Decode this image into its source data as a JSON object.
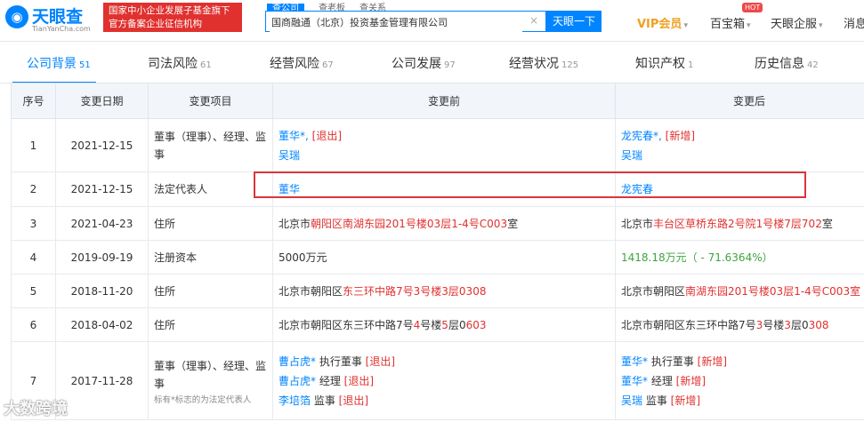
{
  "header": {
    "logo_icon": "eye-icon",
    "logo_name": "天眼查",
    "logo_sub": "TianYanCha.com",
    "gov_line1": "国家中小企业发展子基金旗下",
    "gov_line2": "官方备案企业征信机构",
    "search_tabs": [
      "查公司",
      "查老板",
      "查关系"
    ],
    "search_value": "国商融通（北京）投资基金管理有限公司",
    "search_button": "天眼一下",
    "vip": "VIP会员",
    "baobox": "百宝箱",
    "hot": "HOT",
    "enterprise": "天眼企服",
    "msg": "消息"
  },
  "nav": [
    {
      "label": "公司背景",
      "count": "51"
    },
    {
      "label": "司法风险",
      "count": "61"
    },
    {
      "label": "经营风险",
      "count": "67"
    },
    {
      "label": "公司发展",
      "count": "97"
    },
    {
      "label": "经营状况",
      "count": "125"
    },
    {
      "label": "知识产权",
      "count": "1"
    },
    {
      "label": "历史信息",
      "count": "42"
    }
  ],
  "table": {
    "headers": [
      "序号",
      "变更日期",
      "变更项目",
      "变更前",
      "变更后"
    ],
    "rows": [
      {
        "num": "1",
        "date": "2021-12-15",
        "item": "董事（理事）、经理、监事",
        "before": [
          [
            {
              "t": "董华*, ",
              "c": "nm"
            },
            {
              "t": "[退出]",
              "c": "tag"
            }
          ],
          [
            {
              "t": "吴瑞",
              "c": "nm"
            }
          ]
        ],
        "after": [
          [
            {
              "t": "龙宪春*, ",
              "c": "nm"
            },
            {
              "t": "[新增]",
              "c": "tag"
            }
          ],
          [
            {
              "t": "吴瑞",
              "c": "nm"
            }
          ]
        ]
      },
      {
        "num": "2",
        "date": "2021-12-15",
        "item": "法定代表人",
        "before": [
          [
            {
              "t": "董华",
              "c": "nm"
            }
          ]
        ],
        "after": [
          [
            {
              "t": "龙宪春",
              "c": "nm"
            }
          ]
        ]
      },
      {
        "num": "3",
        "date": "2021-04-23",
        "item": "住所",
        "before": [
          [
            {
              "t": "北京市",
              "c": ""
            },
            {
              "t": "朝阳区南湖东园201号楼03层1-4号C003",
              "c": "hl"
            },
            {
              "t": "室",
              "c": ""
            }
          ]
        ],
        "after": [
          [
            {
              "t": "北京市",
              "c": ""
            },
            {
              "t": "丰台区草桥东路2号院1号楼7层702",
              "c": "hl"
            },
            {
              "t": "室",
              "c": ""
            }
          ]
        ]
      },
      {
        "num": "4",
        "date": "2019-09-19",
        "item": "注册资本",
        "before": [
          [
            {
              "t": "5000万元",
              "c": ""
            }
          ]
        ],
        "after": [
          [
            {
              "t": "1418.18万元（ - 71.6364%）",
              "c": "grn"
            }
          ]
        ]
      },
      {
        "num": "5",
        "date": "2018-11-20",
        "item": "住所",
        "before": [
          [
            {
              "t": "北京市朝阳区",
              "c": ""
            },
            {
              "t": "东三环中路7号3号楼3层0308",
              "c": "hl"
            }
          ]
        ],
        "after": [
          [
            {
              "t": "北京市朝阳区",
              "c": ""
            },
            {
              "t": "南湖东园201号楼03层1-4号C003室",
              "c": "hl"
            }
          ]
        ]
      },
      {
        "num": "6",
        "date": "2018-04-02",
        "item": "住所",
        "before": [
          [
            {
              "t": "北京市朝阳区东三环中路7号",
              "c": ""
            },
            {
              "t": "4",
              "c": "hl"
            },
            {
              "t": "号楼",
              "c": ""
            },
            {
              "t": "5",
              "c": "hl"
            },
            {
              "t": "层0",
              "c": ""
            },
            {
              "t": "603",
              "c": "hl"
            }
          ]
        ],
        "after": [
          [
            {
              "t": "北京市朝阳区东三环中路7号",
              "c": ""
            },
            {
              "t": "3",
              "c": "hl"
            },
            {
              "t": "号楼",
              "c": ""
            },
            {
              "t": "3",
              "c": "hl"
            },
            {
              "t": "层0",
              "c": ""
            },
            {
              "t": "308",
              "c": "hl"
            }
          ]
        ]
      },
      {
        "num": "7",
        "date": "2017-11-28",
        "item": "董事（理事）、经理、监事",
        "note": "标有*标志的为法定代表人",
        "before": [
          [
            {
              "t": "曹占虎*",
              "c": "nm"
            },
            {
              "t": " 执行董事 ",
              "c": ""
            },
            {
              "t": "[退出]",
              "c": "tag"
            }
          ],
          [
            {
              "t": "曹占虎*",
              "c": "nm"
            },
            {
              "t": " 经理 ",
              "c": ""
            },
            {
              "t": "[退出]",
              "c": "tag"
            }
          ],
          [
            {
              "t": "李培箔",
              "c": "nm"
            },
            {
              "t": " 监事 ",
              "c": ""
            },
            {
              "t": "[退出]",
              "c": "tag"
            }
          ]
        ],
        "after": [
          [
            {
              "t": "董华*",
              "c": "nm"
            },
            {
              "t": " 执行董事 ",
              "c": ""
            },
            {
              "t": "[新增]",
              "c": "tag"
            }
          ],
          [
            {
              "t": "董华*",
              "c": "nm"
            },
            {
              "t": " 经理 ",
              "c": ""
            },
            {
              "t": "[新增]",
              "c": "tag"
            }
          ],
          [
            {
              "t": "吴瑞",
              "c": "nm"
            },
            {
              "t": " 监事 ",
              "c": ""
            },
            {
              "t": "[新增]",
              "c": "tag"
            }
          ]
        ]
      }
    ]
  },
  "watermark": "大数跨境"
}
